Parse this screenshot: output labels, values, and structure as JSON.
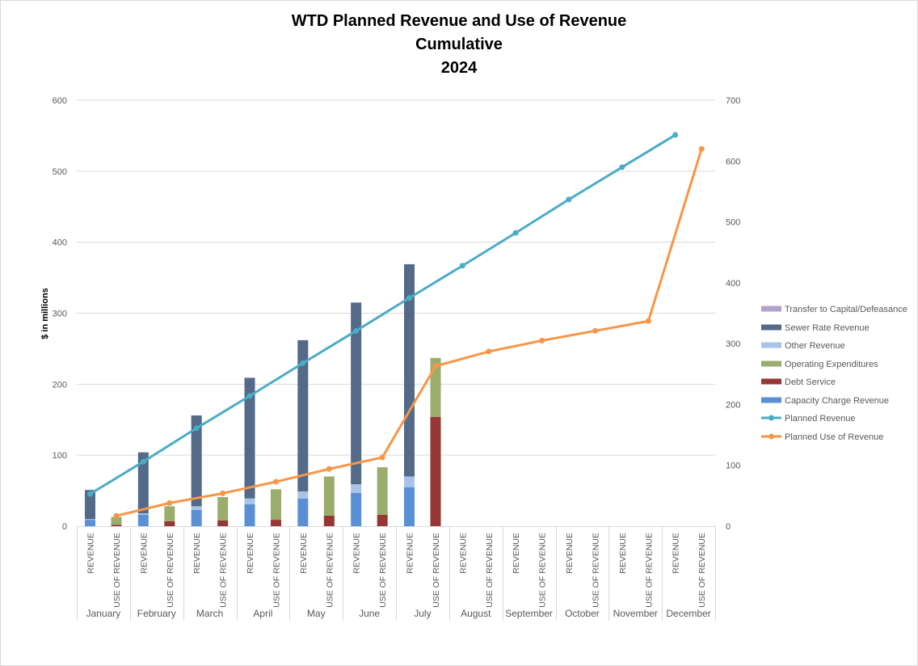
{
  "chart_data": {
    "type": "bar",
    "subtype": "stacked-bar-with-lines",
    "title": [
      "WTD Planned Revenue and Use of Revenue",
      "Cumulative",
      "2024"
    ],
    "ylabel": "$ in millions",
    "ylim": [
      0,
      600
    ],
    "yticks": [
      0,
      100,
      200,
      300,
      400,
      500,
      600
    ],
    "y2lim": [
      0,
      700
    ],
    "y2ticks": [
      0,
      100,
      200,
      300,
      400,
      500,
      600,
      700
    ],
    "grid": true,
    "legend_position": "right",
    "months": [
      "January",
      "February",
      "March",
      "April",
      "May",
      "June",
      "July",
      "August",
      "September",
      "October",
      "November",
      "December"
    ],
    "sub_categories": [
      "REVENUE",
      "USE OF REVENUE"
    ],
    "colors": {
      "transfer": "#B3A2C7",
      "sewer": "#536A89",
      "other": "#A9C4E8",
      "operating": "#9BAD6C",
      "debt": "#953735",
      "capacity": "#5A8FD6",
      "planned_revenue": "#4BACC6",
      "planned_use": "#F79646",
      "grid": "#D9D9D9",
      "axis": "#D9D9D9"
    },
    "revenue_series": [
      {
        "key": "capacity",
        "name": "Capacity Charge Revenue",
        "values": [
          9,
          16,
          23,
          31,
          39,
          47,
          55,
          null,
          null,
          null,
          null,
          null
        ]
      },
      {
        "key": "other",
        "name": "Other Revenue",
        "values": [
          1,
          2,
          5,
          8,
          10,
          12,
          15,
          null,
          null,
          null,
          null,
          null
        ]
      },
      {
        "key": "sewer",
        "name": "Sewer Rate Revenue",
        "values": [
          41,
          86,
          128,
          170,
          213,
          256,
          299,
          null,
          null,
          null,
          null,
          null
        ]
      }
    ],
    "use_series": [
      {
        "key": "debt",
        "name": "Debt Service",
        "values": [
          2,
          7,
          8,
          9,
          15,
          16,
          154,
          null,
          null,
          null,
          null,
          null
        ]
      },
      {
        "key": "operating",
        "name": "Operating Expenditures",
        "values": [
          11,
          21,
          33,
          43,
          55,
          67,
          83,
          null,
          null,
          null,
          null,
          null
        ]
      },
      {
        "key": "transfer",
        "name": "Transfer to Capital/Defeasance",
        "values": [
          0,
          0,
          0,
          0,
          0,
          0,
          0,
          null,
          null,
          null,
          null,
          null
        ]
      }
    ],
    "line_series": [
      {
        "key": "planned_revenue",
        "name": "Planned Revenue",
        "axis": "right",
        "position": "REVENUE",
        "values": [
          53,
          106,
          161,
          214,
          268,
          321,
          375,
          428,
          482,
          537,
          590,
          643
        ]
      },
      {
        "key": "planned_use",
        "name": "Planned Use of Revenue",
        "axis": "right",
        "position": "USE OF REVENUE",
        "values": [
          17,
          38,
          54,
          73,
          94,
          113,
          263,
          287,
          305,
          321,
          337,
          620
        ]
      }
    ],
    "legend": [
      {
        "key": "transfer",
        "label": "Transfer to Capital/Defeasance",
        "kind": "bar"
      },
      {
        "key": "sewer",
        "label": "Sewer Rate Revenue",
        "kind": "bar"
      },
      {
        "key": "other",
        "label": "Other Revenue",
        "kind": "bar"
      },
      {
        "key": "operating",
        "label": "Operating Expenditures",
        "kind": "bar"
      },
      {
        "key": "debt",
        "label": "Debt Service",
        "kind": "bar"
      },
      {
        "key": "capacity",
        "label": "Capacity Charge Revenue",
        "kind": "bar"
      },
      {
        "key": "planned_revenue",
        "label": "Planned Revenue",
        "kind": "line"
      },
      {
        "key": "planned_use",
        "label": "Planned Use of Revenue",
        "kind": "line"
      }
    ]
  }
}
